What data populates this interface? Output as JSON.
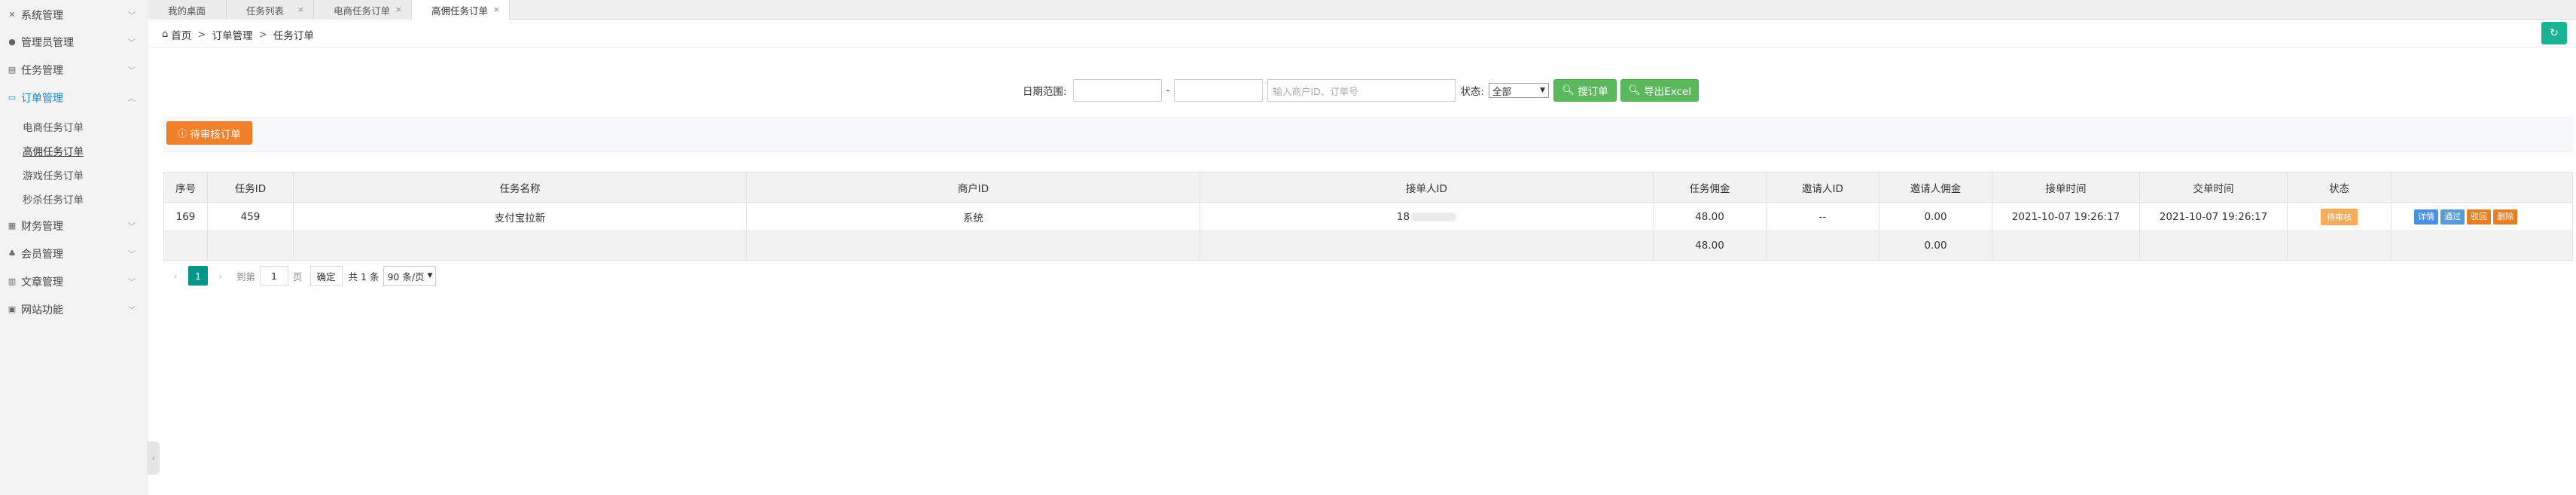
{
  "sidebar": {
    "menus": [
      {
        "label": "系统管理",
        "icon": "tools-icon"
      },
      {
        "label": "管理员管理",
        "icon": "user-icon"
      },
      {
        "label": "任务管理",
        "icon": "list-icon"
      },
      {
        "label": "订单管理",
        "icon": "order-icon"
      },
      {
        "label": "财务管理",
        "icon": "finance-icon"
      },
      {
        "label": "会员管理",
        "icon": "members-icon"
      },
      {
        "label": "文章管理",
        "icon": "article-icon"
      },
      {
        "label": "网站功能",
        "icon": "site-icon"
      }
    ],
    "order_submenu": [
      "电商任务订单",
      "高佣任务订单",
      "游戏任务订单",
      "秒杀任务订单"
    ]
  },
  "tabs": [
    {
      "label": "我的桌面"
    },
    {
      "label": "任务列表"
    },
    {
      "label": "电商任务订单"
    },
    {
      "label": "高佣任务订单"
    }
  ],
  "breadcrumb": {
    "home": "首页",
    "level1": "订单管理",
    "level2": "任务订单",
    "sep": ">"
  },
  "search": {
    "date_label": "日期范围:",
    "range_sep": "-",
    "keyword_placeholder": "输入商户ID、订单号",
    "status_label": "状态:",
    "status_value": "全部",
    "search_button": "搜订单",
    "export_button": "导出Excel"
  },
  "toolbar": {
    "pending_button": "待审核订单"
  },
  "table": {
    "headers": [
      "序号",
      "任务ID",
      "任务名称",
      "商户ID",
      "接单人ID",
      "任务佣金",
      "邀请人ID",
      "邀请人佣金",
      "接单时间",
      "交单时间",
      "状态",
      ""
    ],
    "rows": [
      {
        "seq": "169",
        "task_id": "459",
        "task_name": "支付宝拉新",
        "merchant_id": "系统",
        "receiver_id": "18",
        "commission": "48.00",
        "inviter_id": "--",
        "inviter_commission": "0.00",
        "accept_time": "2021-10-07 19:26:17",
        "submit_time": "2021-10-07 19:26:17",
        "status": "待审核",
        "actions": [
          "详情",
          "通过",
          "驳回",
          "删除"
        ]
      }
    ],
    "totals": {
      "commission": "48.00",
      "inviter_commission": "0.00"
    }
  },
  "pager": {
    "prev": "‹",
    "current": "1",
    "next": "›",
    "goto_label": "到第",
    "goto_value": "1",
    "page_unit": "页",
    "confirm": "确定",
    "total": "共 1 条",
    "per_page": "90 条/页"
  }
}
